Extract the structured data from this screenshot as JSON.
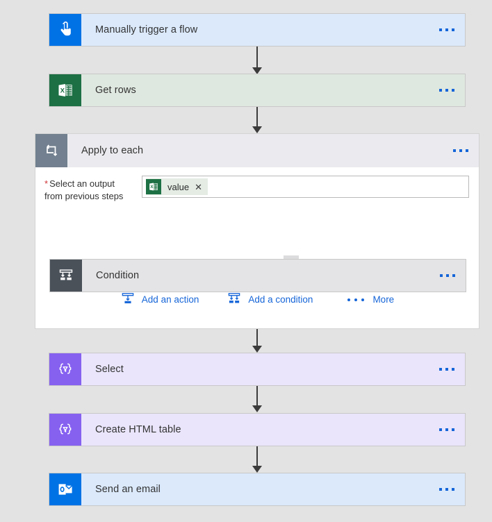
{
  "flow": {
    "steps": [
      {
        "id": "trigger",
        "title": "Manually trigger a flow",
        "icon": "manual-trigger-icon",
        "card_color": "#dbe9fb",
        "icon_color": "#0072e5",
        "menu": "ellipsis-menu"
      },
      {
        "id": "get-rows",
        "title": "Get rows",
        "icon": "excel-icon",
        "card_color": "#dfe8e0",
        "icon_color": "#1d7044",
        "menu": "ellipsis-menu"
      },
      {
        "id": "apply-to-each",
        "title": "Apply to each",
        "icon": "loop-icon",
        "card_color": "#ebebef",
        "icon_color": "#72808f",
        "menu": "ellipsis-menu"
      },
      {
        "id": "condition",
        "title": "Condition",
        "icon": "condition-branch-icon",
        "card_color": "#e4e4e6",
        "icon_color": "#4a5159",
        "menu": "ellipsis-menu"
      },
      {
        "id": "select",
        "title": "Select",
        "icon": "data-operation-icon",
        "card_color": "#eae5fb",
        "icon_color": "#8661f0",
        "menu": "ellipsis-menu"
      },
      {
        "id": "create-html-table",
        "title": "Create HTML table",
        "icon": "data-operation-icon",
        "card_color": "#eae5fb",
        "icon_color": "#8661f0",
        "menu": "ellipsis-menu"
      },
      {
        "id": "send-an-email",
        "title": "Send an email",
        "icon": "outlook-icon",
        "card_color": "#dbe9fb",
        "icon_color": "#0072e5",
        "menu": "ellipsis-menu"
      }
    ],
    "apply_to_each": {
      "field": {
        "required_marker": "*",
        "label": "Select an output from previous steps",
        "label_line1": "Select an output",
        "label_line2": "from previous steps",
        "token": {
          "label": "value",
          "icon": "excel-icon",
          "remove": "✕"
        },
        "placeholder": ""
      },
      "actions": [
        {
          "id": "add-an-action",
          "label": "Add an action",
          "icon": "add-action-icon"
        },
        {
          "id": "add-a-condition",
          "label": "Add a condition",
          "icon": "add-condition-icon"
        },
        {
          "id": "more",
          "label": "More",
          "icon": "more-ellipsis-icon"
        }
      ]
    }
  },
  "theme": {
    "canvas_background": "#e3e3e3",
    "accent_blue": "#1565d8",
    "arrow_color": "#3b3b3b",
    "required_red": "#d13438"
  }
}
